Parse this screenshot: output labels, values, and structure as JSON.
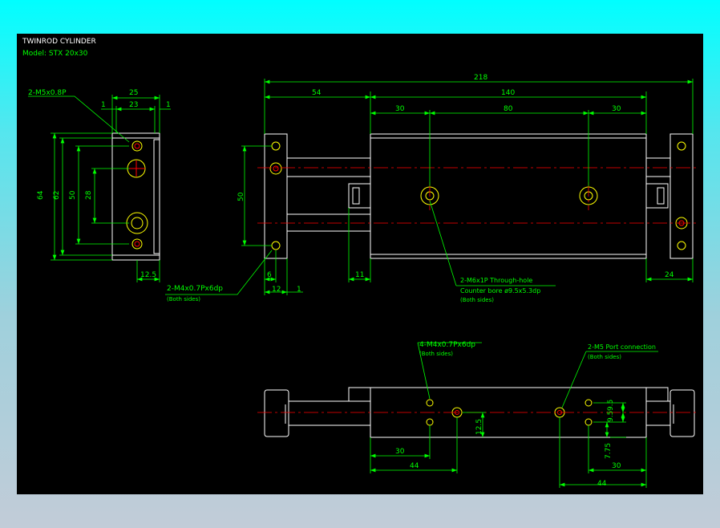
{
  "header": {
    "title": "TWINROD CYLINDER",
    "model": "Model: STX 20x30"
  },
  "colors": {
    "outline": "#ffffff",
    "dimension": "#00ff00",
    "centerline": "#ff0000",
    "hole": "#ffff00",
    "background": "#000000"
  },
  "dimensions": {
    "overall_length": "218",
    "d54": "54",
    "d140": "140",
    "d30a": "30",
    "d80": "80",
    "d30b": "30",
    "d50_front": "50",
    "d6": "6",
    "d12": "12",
    "d1c": "1",
    "d11": "11",
    "d24": "24",
    "side_25": "25",
    "side_23": "23",
    "side_1a": "1",
    "side_1b": "1",
    "side_64": "64",
    "side_62": "62",
    "side_50": "50",
    "side_28": "28",
    "side_12_5": "12.5",
    "bot_30": "30",
    "bot_44": "44",
    "bot_12_5": "12.5",
    "bot_9_5a": "9.5",
    "bot_9_5b": "9.5",
    "bot_7_75": "7.75",
    "bot_30b": "30",
    "bot_44b": "44"
  },
  "notes": {
    "m5_thread": "2-M5x0.8P",
    "m4_title": "2-M4x0.7Px6dp",
    "m4_sub": "(Both sides)",
    "m6_title": "2-M6x1P Through-hole",
    "m6_cb": "Counter bore ø9.5x5.3dp",
    "m6_sub": "(Both sides)",
    "m4b_title": "4-M4x0.7Px6dp",
    "m4b_sub": "(Both sides)",
    "port_title": "2-M5 Port connection",
    "port_sub": "(Both sides)"
  }
}
